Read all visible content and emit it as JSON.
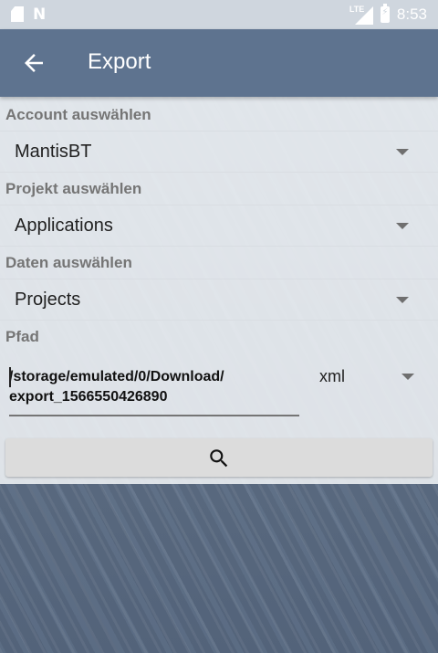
{
  "status_bar": {
    "icons": [
      "sd-card-icon",
      "n-icon",
      "lte-signal-icon",
      "battery-charging-icon"
    ],
    "network_label": "LTE",
    "time": "8:53"
  },
  "toolbar": {
    "title": "Export",
    "back_icon": "arrow-left-icon"
  },
  "form": {
    "account": {
      "label": "Account auswählen",
      "value": "MantisBT"
    },
    "project": {
      "label": "Projekt auswählen",
      "value": "Applications"
    },
    "data": {
      "label": "Daten auswählen",
      "value": "Projects"
    },
    "path": {
      "label": "Pfad",
      "value": "/storage/emulated/0/Download/\nexport_1566550426890",
      "format": "xml"
    },
    "search_button": {
      "icon": "search-icon"
    }
  },
  "colors": {
    "toolbar": "#5e738f",
    "status_bar": "#cfd6de",
    "form_background": "#ecf0f3",
    "label": "#757575"
  }
}
